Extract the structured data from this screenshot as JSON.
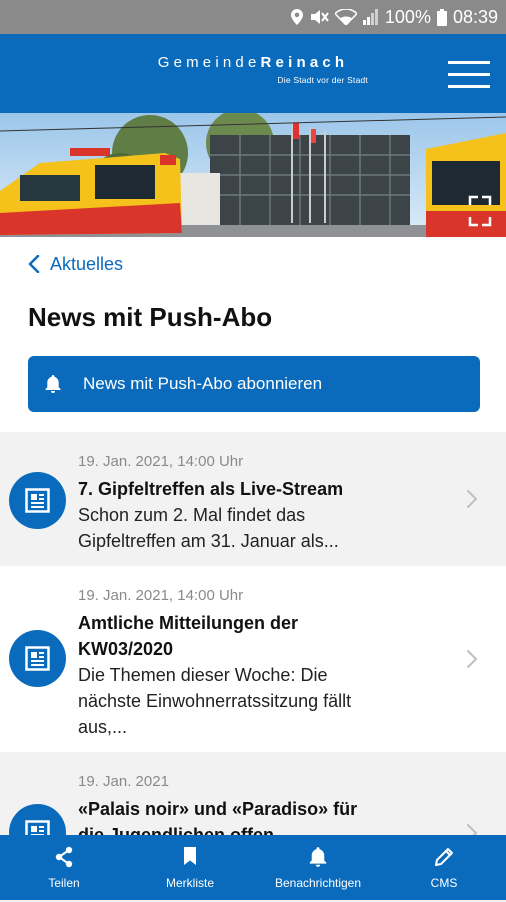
{
  "status_bar": {
    "battery": "100%",
    "time": "08:39"
  },
  "header": {
    "title_part1": "Gemeinde",
    "title_part2": "Reinach",
    "subtitle": "Die Stadt vor der Stadt"
  },
  "breadcrumb": {
    "back_label": "Aktuelles"
  },
  "page": {
    "title": "News mit Push-Abo",
    "subscribe_label": "News mit Push-Abo abonnieren"
  },
  "news": [
    {
      "date": "19. Jan. 2021, 14:00 Uhr",
      "title": "7. Gipfeltreffen als Live-Stream",
      "desc_line1": "Schon zum 2. Mal findet das",
      "desc_line2": "Gipfeltreffen am 31. Januar als..."
    },
    {
      "date": "19. Jan. 2021, 14:00 Uhr",
      "title_line1": "Amtliche Mitteilungen der",
      "title_line2": "KW03/2020",
      "desc_line1": "Die Themen dieser Woche: Die",
      "desc_line2": "nächste Einwohnerratssitzung fällt",
      "desc_line3": "aus,..."
    },
    {
      "date": "19. Jan. 2021",
      "title_line1": "«Palais noir» und «Paradiso» für",
      "title_line2": "die Jugendlichen offen"
    }
  ],
  "bottom_nav": {
    "share": "Teilen",
    "bookmarks": "Merkliste",
    "notifications": "Benachrichtigen",
    "cms": "CMS"
  },
  "colors": {
    "brand_blue": "#0a6bbd",
    "statusbar_gray": "#8a8a8a",
    "row_shade": "#f2f2f2"
  }
}
